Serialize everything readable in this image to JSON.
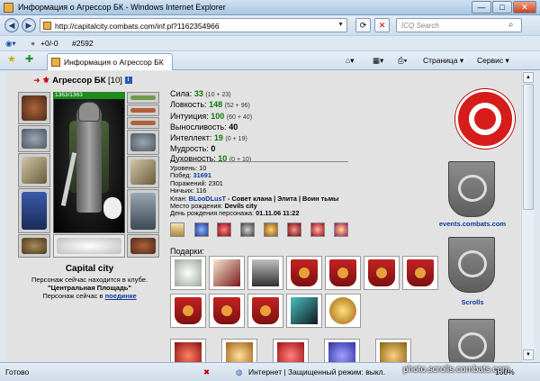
{
  "window": {
    "title": "Информация о Агрессор БК - Windows Internet Explorer",
    "minimize": "—",
    "maximize": "□",
    "close": "✕"
  },
  "addressbar": {
    "url": "http://capitalcity.combats.com/inf.pl?1162354966",
    "search_placeholder": "ICQ Search"
  },
  "toolbar": {
    "counter": "+0/-0",
    "id": "#2592"
  },
  "tab": {
    "title": "Информация о Агрессор БК"
  },
  "tools": {
    "page": "Страница",
    "service": "Сервис"
  },
  "character": {
    "name": "Агрессор БК",
    "level": "[10]",
    "hp": "1363/1363",
    "info_icon": "i"
  },
  "location": {
    "city": "Capital city",
    "line1": "Персонаж сейчас находится в клубе.",
    "line2": "\"Центральная Площадь\"",
    "line3_prefix": "Персонаж сейчас в",
    "line3_link": "поединке"
  },
  "stats": [
    {
      "label": "Сила:",
      "value": "33",
      "extra": "(10 + 23)"
    },
    {
      "label": "Ловкость:",
      "value": "148",
      "extra": "(52 + 96)"
    },
    {
      "label": "Интуиция:",
      "value": "100",
      "extra": "(60 + 40)"
    },
    {
      "label": "Выносливость:",
      "value": "40",
      "extra": ""
    },
    {
      "label": "Интеллект:",
      "value": "19",
      "extra": "(0 + 19)"
    },
    {
      "label": "Мудрость:",
      "value": "0",
      "extra": ""
    },
    {
      "label": "Духовность:",
      "value": "10",
      "extra": "(0 + 10)"
    }
  ],
  "info": {
    "level": "Уровень: 10",
    "wins_label": "Побед:",
    "wins": "31691",
    "losses": "Поражений: 2301",
    "draws": "Ничьих: 116",
    "clan_label": "Клан:",
    "clan": "BLooDLusT",
    "clan_role": "- Совет клана | Элита | Воин тьмы",
    "birthplace_label": "Место рождения:",
    "birthplace": "Devils city",
    "birthday_label": "День рождения персонажа:",
    "birthday": "01.11.06 11:22"
  },
  "gifts": {
    "title": "Подарки:"
  },
  "sidebar": {
    "events_label": "events.combats.com",
    "scrolls_label": "Scrolls"
  },
  "status": {
    "left": "Готово",
    "zone": "Интернет | Защищенный режим: выкл.",
    "zoom": "100%"
  },
  "watermark": "photo.scrolls.combats.com",
  "colors": {
    "stat_value": "#0b7a0b",
    "link": "#0b3a9b",
    "logo_red": "#d71c1c"
  }
}
